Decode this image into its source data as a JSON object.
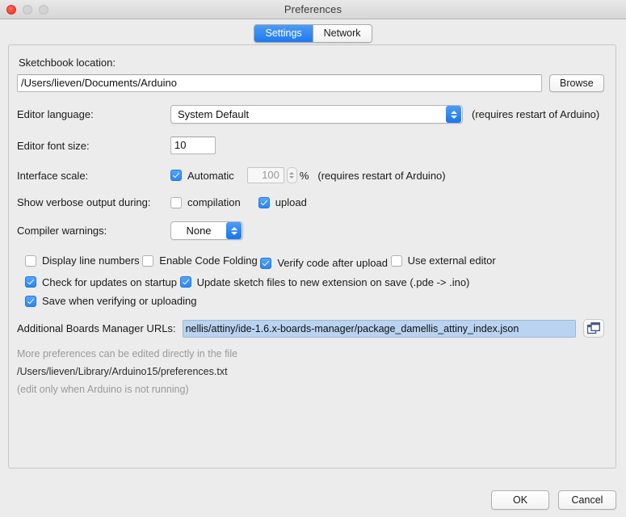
{
  "window": {
    "title": "Preferences",
    "traffic_lights": [
      "close-button",
      "minimize-button",
      "maximize-button"
    ]
  },
  "tabs": [
    {
      "label": "Settings",
      "active": true
    },
    {
      "label": "Network",
      "active": false
    }
  ],
  "settings": {
    "sketchbook": {
      "label": "Sketchbook location:",
      "value": "/Users/lieven/Documents/Arduino",
      "browse_label": "Browse"
    },
    "editor_language": {
      "label": "Editor language:",
      "value": "System Default",
      "note": "(requires restart of Arduino)"
    },
    "editor_font_size": {
      "label": "Editor font size:",
      "value": "10"
    },
    "interface_scale": {
      "label": "Interface scale:",
      "automatic_label": "Automatic",
      "automatic_checked": true,
      "scale_value": "100",
      "percent_symbol": "%",
      "note": "(requires restart of Arduino)"
    },
    "verbose_output": {
      "label": "Show verbose output during:",
      "options": [
        {
          "label": "compilation",
          "checked": false
        },
        {
          "label": "upload",
          "checked": true
        }
      ]
    },
    "compiler_warnings": {
      "label": "Compiler warnings:",
      "value": "None"
    },
    "checkboxes": [
      {
        "label": "Display line numbers",
        "checked": false
      },
      {
        "label": "Enable Code Folding",
        "checked": false
      },
      {
        "label": "Verify code after upload",
        "checked": true
      },
      {
        "label": "Use external editor",
        "checked": false
      },
      {
        "label": "Check for updates on startup",
        "checked": true
      },
      {
        "label": "Update sketch files to new extension on save (.pde -> .ino)",
        "checked": true
      },
      {
        "label": "Save when verifying or uploading",
        "checked": true
      }
    ],
    "boards_manager": {
      "label": "Additional Boards Manager URLs:",
      "value": "nellis/attiny/ide-1.6.x-boards-manager/package_damellis_attiny_index.json",
      "edit_button_icon": "windows-cascade-icon"
    },
    "footer": {
      "line1": "More preferences can be edited directly in the file",
      "line2": "/Users/lieven/Library/Arduino15/preferences.txt",
      "line3": "(edit only when Arduino is not running)"
    }
  },
  "buttons": {
    "ok": "OK",
    "cancel": "Cancel"
  },
  "colors": {
    "accent_blue": "#2a86f2",
    "selection_blue": "#b9d3f0",
    "window_bg": "#ececec",
    "close_red": "#f2392b"
  }
}
